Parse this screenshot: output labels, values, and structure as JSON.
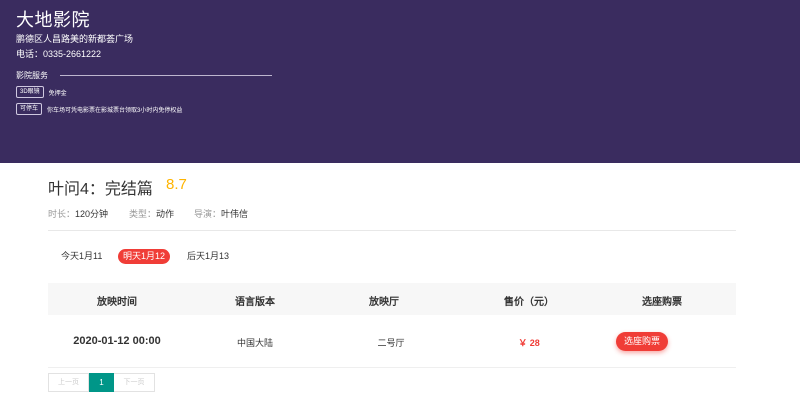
{
  "cinema": {
    "name": "大地影院",
    "address": "鹏德区人昌路美的新都荟广场",
    "phone": "电话：0335-2661222",
    "services_title": "影院服务",
    "services": [
      {
        "tag": "3D眼镜",
        "desc": "免押金"
      },
      {
        "tag": "可停车",
        "desc": "你车场可凭电影票在影城票台领取3小时内免停权益"
      }
    ]
  },
  "movie": {
    "title": "叶问4：完结篇",
    "score": "8.7",
    "duration_label": "时长：",
    "duration": "120分钟",
    "type_label": "类型：",
    "type": "动作",
    "director_label": "导演：",
    "director": "叶伟信"
  },
  "date_tabs": [
    {
      "label": "今天1月11",
      "active": false
    },
    {
      "label": "明天1月12",
      "active": true
    },
    {
      "label": "后天1月13",
      "active": false
    }
  ],
  "table": {
    "headers": [
      "放映时间",
      "语言版本",
      "放映厅",
      "售价（元）",
      "选座购票"
    ],
    "rows": [
      {
        "time": "2020-01-12 00:00",
        "language": "中国大陆",
        "hall": "二号厅",
        "price": "￥ 28",
        "action": "选座购票"
      }
    ]
  },
  "pagination": {
    "prev": "上一页",
    "current": "1",
    "next": "下一页"
  },
  "colors": {
    "header_bg": "#3a2c5f",
    "accent_red": "#f03d37",
    "score_yellow": "#ffb400",
    "pager_active": "#009688"
  }
}
